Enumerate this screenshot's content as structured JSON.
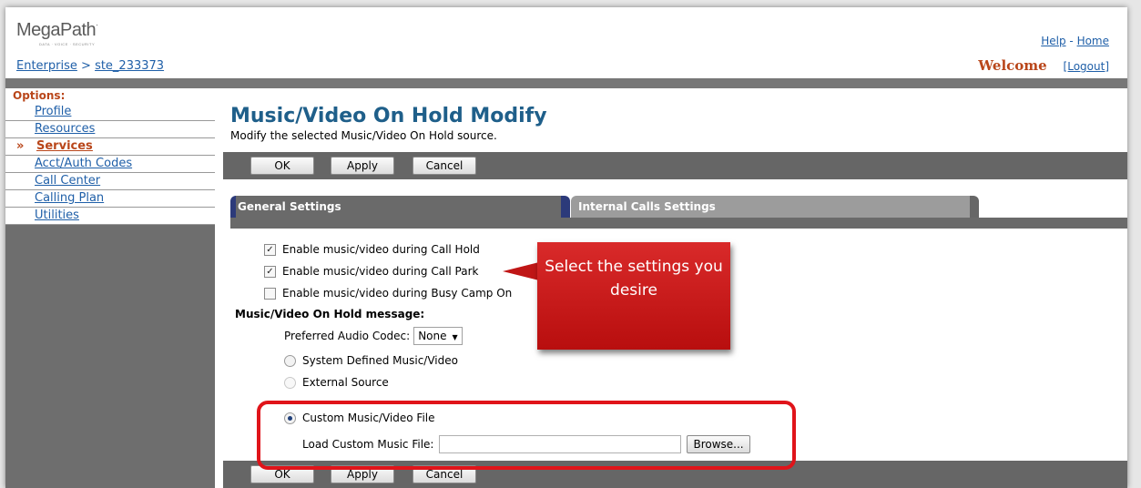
{
  "header": {
    "logo_text": "MegaPath",
    "logo_tagline": "DATA · VOICE · SECURITY",
    "breadcrumb": {
      "enterprise": "Enterprise",
      "separator": ">",
      "site": "ste_233373"
    },
    "help": "Help",
    "dash": "-",
    "home": "Home",
    "welcome": "Welcome",
    "logout": "[Logout]"
  },
  "sidebar": {
    "heading": "Options:",
    "items": [
      {
        "label": "Profile"
      },
      {
        "label": "Resources"
      },
      {
        "label": "Services",
        "active": true,
        "marker": "»"
      },
      {
        "label": "Acct/Auth Codes"
      },
      {
        "label": "Call Center"
      },
      {
        "label": "Calling Plan"
      },
      {
        "label": "Utilities"
      }
    ]
  },
  "page": {
    "title": "Music/Video On Hold Modify",
    "subtitle": "Modify the selected Music/Video On Hold source."
  },
  "buttons": {
    "ok": "OK",
    "apply": "Apply",
    "cancel": "Cancel"
  },
  "tabs": [
    {
      "label": "General Settings",
      "active": true
    },
    {
      "label": "Internal Calls Settings",
      "active": false
    }
  ],
  "form": {
    "call_hold": {
      "label": "Enable music/video during Call Hold",
      "checked": true
    },
    "call_park": {
      "label": "Enable music/video during Call Park",
      "checked": true
    },
    "busy_camp": {
      "label": "Enable music/video during Busy Camp On",
      "checked": false
    },
    "message_heading": "Music/Video On Hold message:",
    "codec_label": "Preferred Audio Codec:",
    "codec_value": "None",
    "options": [
      {
        "label": "System Defined Music/Video",
        "selected": false
      },
      {
        "label": "External Source",
        "selected": false,
        "disabled": true
      },
      {
        "label": "Custom Music/Video File",
        "selected": true
      }
    ],
    "load_label": "Load Custom Music File:",
    "browse": "Browse..."
  },
  "callout": {
    "text": "Select the settings you desire"
  },
  "colors": {
    "accent_red": "#e0141a",
    "link_blue": "#1f5fa8",
    "title_blue": "#1f5f8a",
    "active_orange": "#b9461a"
  }
}
